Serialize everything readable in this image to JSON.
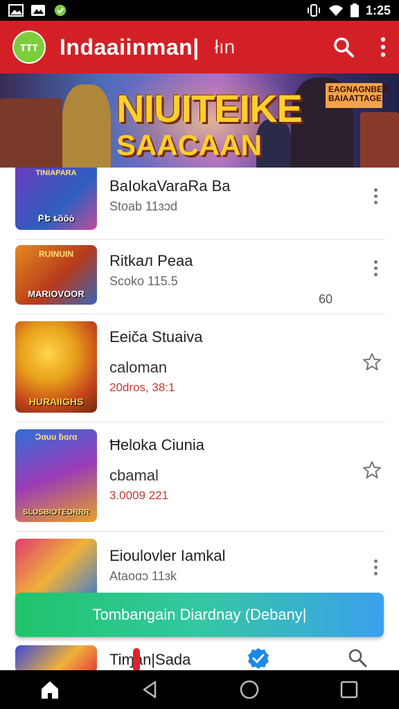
{
  "status_bar": {
    "time": "1:25",
    "left_icons": [
      "image-icon",
      "photos-icon",
      "app-notification-icon"
    ],
    "right_icons": [
      "vibrate-icon",
      "wifi-icon",
      "battery-icon"
    ]
  },
  "app_bar": {
    "logo_text": "ттт",
    "title": "Indaaiinman|",
    "subtitle": "łın",
    "actions": [
      "search-icon",
      "more-vert-icon"
    ]
  },
  "banner": {
    "title": "NIUITEIKE",
    "subtitle": "SAACAAN",
    "badge_line1": "EAGNAGNBEA",
    "badge_line2": "BAIAATTAGE"
  },
  "items": [
    {
      "title": "BaIokaVaraRa Ba",
      "subtitle": "Stoab 11ɜɔd",
      "thumb_top": "TINIAPARA",
      "thumb_bottom": "ԲԵ ȶȍȏȯ",
      "action": "more-vert-icon",
      "thumb_colors": [
        "#6a3bbd",
        "#2d5fbf",
        "#c34e9a"
      ]
    },
    {
      "title": "Ritkaл Peaa",
      "subtitle": "Scoko 115.5",
      "right_number": "60",
      "thumb_top": "RUINUIN",
      "thumb_bottom": "MARIOVOOR",
      "action": "more-vert-icon",
      "thumb_colors": [
        "#e58a1f",
        "#b63a1c",
        "#3a66b8"
      ]
    },
    {
      "title": "Eeiča Stuaiva",
      "subtitle": "caloman",
      "meta_red": "20dros, 38:1",
      "thumb_bottom": "HURAIIGHS",
      "action": "star-outline-icon",
      "thumb_colors": [
        "#e8a21c",
        "#c4431b",
        "#6a2a10"
      ]
    },
    {
      "title": "Ħeloka Ciunia",
      "subtitle": "cbamal",
      "meta_red": "3.0009 221",
      "thumb_top": "Ɔɑuu ɓɑɾɑ",
      "thumb_bottom": "SLOSBIOTEORRR",
      "action": "star-outline-icon",
      "thumb_colors": [
        "#2f6fd6",
        "#9b3bb8",
        "#e6a325"
      ]
    },
    {
      "title": "Eioulovler Iamkal",
      "subtitle": "Ataoɑɔ 11ɜk",
      "action": "more-vert-icon",
      "thumb_colors": [
        "#e03b6d",
        "#f0b23a",
        "#3b7ad8"
      ]
    }
  ],
  "cta": {
    "label": "Tombangain Diardnay (Debany|"
  },
  "bottom_strip": {
    "title": "Tiɱan|Sada",
    "icons": [
      "check-badge-icon",
      "search-icon"
    ]
  },
  "nav_bar": {
    "buttons": [
      "home-icon",
      "back-icon",
      "home-circle-icon",
      "recents-icon"
    ]
  },
  "colors": {
    "app_bar": "#d32027",
    "cta_start": "#20c46a",
    "cta_end": "#3aa0ee",
    "meta_red": "#c23a33",
    "check_blue": "#1e88e5"
  }
}
